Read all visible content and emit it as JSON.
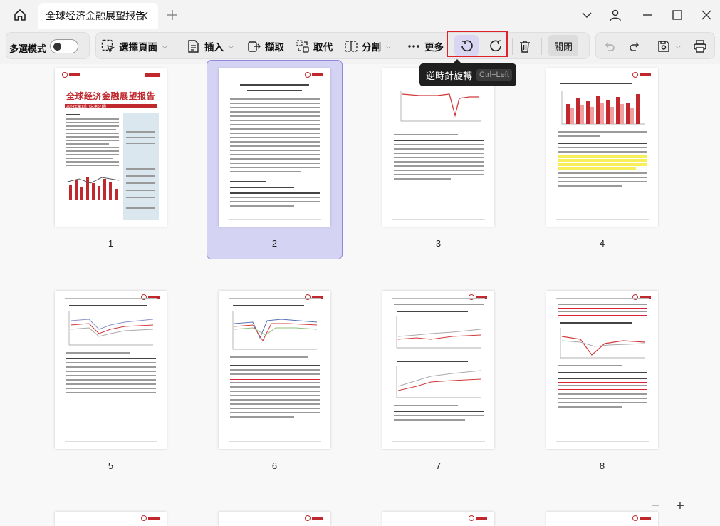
{
  "tab": {
    "title": "全球经济金融展望报告"
  },
  "toolbar": {
    "multi_select_label": "多選模式",
    "select_pages": "選擇頁面",
    "insert": "插入",
    "extract": "擷取",
    "replace": "取代",
    "split": "分割",
    "more": "更多",
    "close": "關閉"
  },
  "tooltip": {
    "text": "逆時針旋轉",
    "shortcut": "Ctrl+Left"
  },
  "pages": [
    "1",
    "2",
    "3",
    "4",
    "5",
    "6",
    "7",
    "8"
  ],
  "selected_page": "2",
  "page1": {
    "title": "全球经济金融展望报告",
    "subtitle": "2024年第1季（总第57期）"
  },
  "zoom": {
    "out": "−",
    "in": "+"
  },
  "colors": {
    "accent": "#7b73d8",
    "highlight_border": "#e0202a",
    "brand_red": "#c0282d"
  }
}
